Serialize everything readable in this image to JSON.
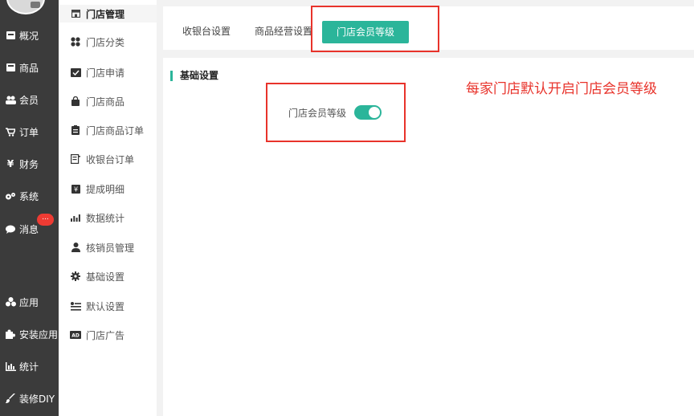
{
  "nav": {
    "items": [
      {
        "label": "概况",
        "icon": "dashboard-icon"
      },
      {
        "label": "商品",
        "icon": "goods-icon"
      },
      {
        "label": "会员",
        "icon": "members-icon"
      },
      {
        "label": "订单",
        "icon": "cart-icon"
      },
      {
        "label": "财务",
        "icon": "yen-icon"
      },
      {
        "label": "系统",
        "icon": "cogs-icon"
      },
      {
        "label": "消息",
        "icon": "message-icon"
      },
      {
        "label": "应用",
        "icon": "apps-icon"
      },
      {
        "label": "安装应用",
        "icon": "puzzle-icon"
      },
      {
        "label": "统计",
        "icon": "bar-chart-icon"
      },
      {
        "label": "装修DIY",
        "icon": "brush-icon"
      }
    ],
    "message_badge": "..."
  },
  "submenu": {
    "items": [
      {
        "label": "门店管理",
        "icon": "store-icon",
        "active": true
      },
      {
        "label": "门店分类",
        "icon": "category-icon"
      },
      {
        "label": "门店申请",
        "icon": "application-icon"
      },
      {
        "label": "门店商品",
        "icon": "bag-icon"
      },
      {
        "label": "门店商品订单",
        "icon": "clipboard-icon"
      },
      {
        "label": "收银台订单",
        "icon": "receipt-icon"
      },
      {
        "label": "提成明细",
        "icon": "commission-icon"
      },
      {
        "label": "数据统计",
        "icon": "stats-icon"
      },
      {
        "label": "核销员管理",
        "icon": "user-icon"
      },
      {
        "label": "基础设置",
        "icon": "gear-icon"
      },
      {
        "label": "默认设置",
        "icon": "sliders-icon"
      },
      {
        "label": "门店广告",
        "icon": "ad-icon"
      }
    ]
  },
  "tabs": [
    {
      "label": "收银台设置"
    },
    {
      "label": "商品经营设置"
    },
    {
      "label": "门店会员等级",
      "active": true
    }
  ],
  "content": {
    "section_title": "基础设置",
    "field_label": "门店会员等级",
    "toggle_on": true,
    "annotation": "每家门店默认开启门店会员等级"
  },
  "colors": {
    "accent": "#2bb59a",
    "nav_bg": "#3b3b3b",
    "highlight": "#e8332b"
  }
}
